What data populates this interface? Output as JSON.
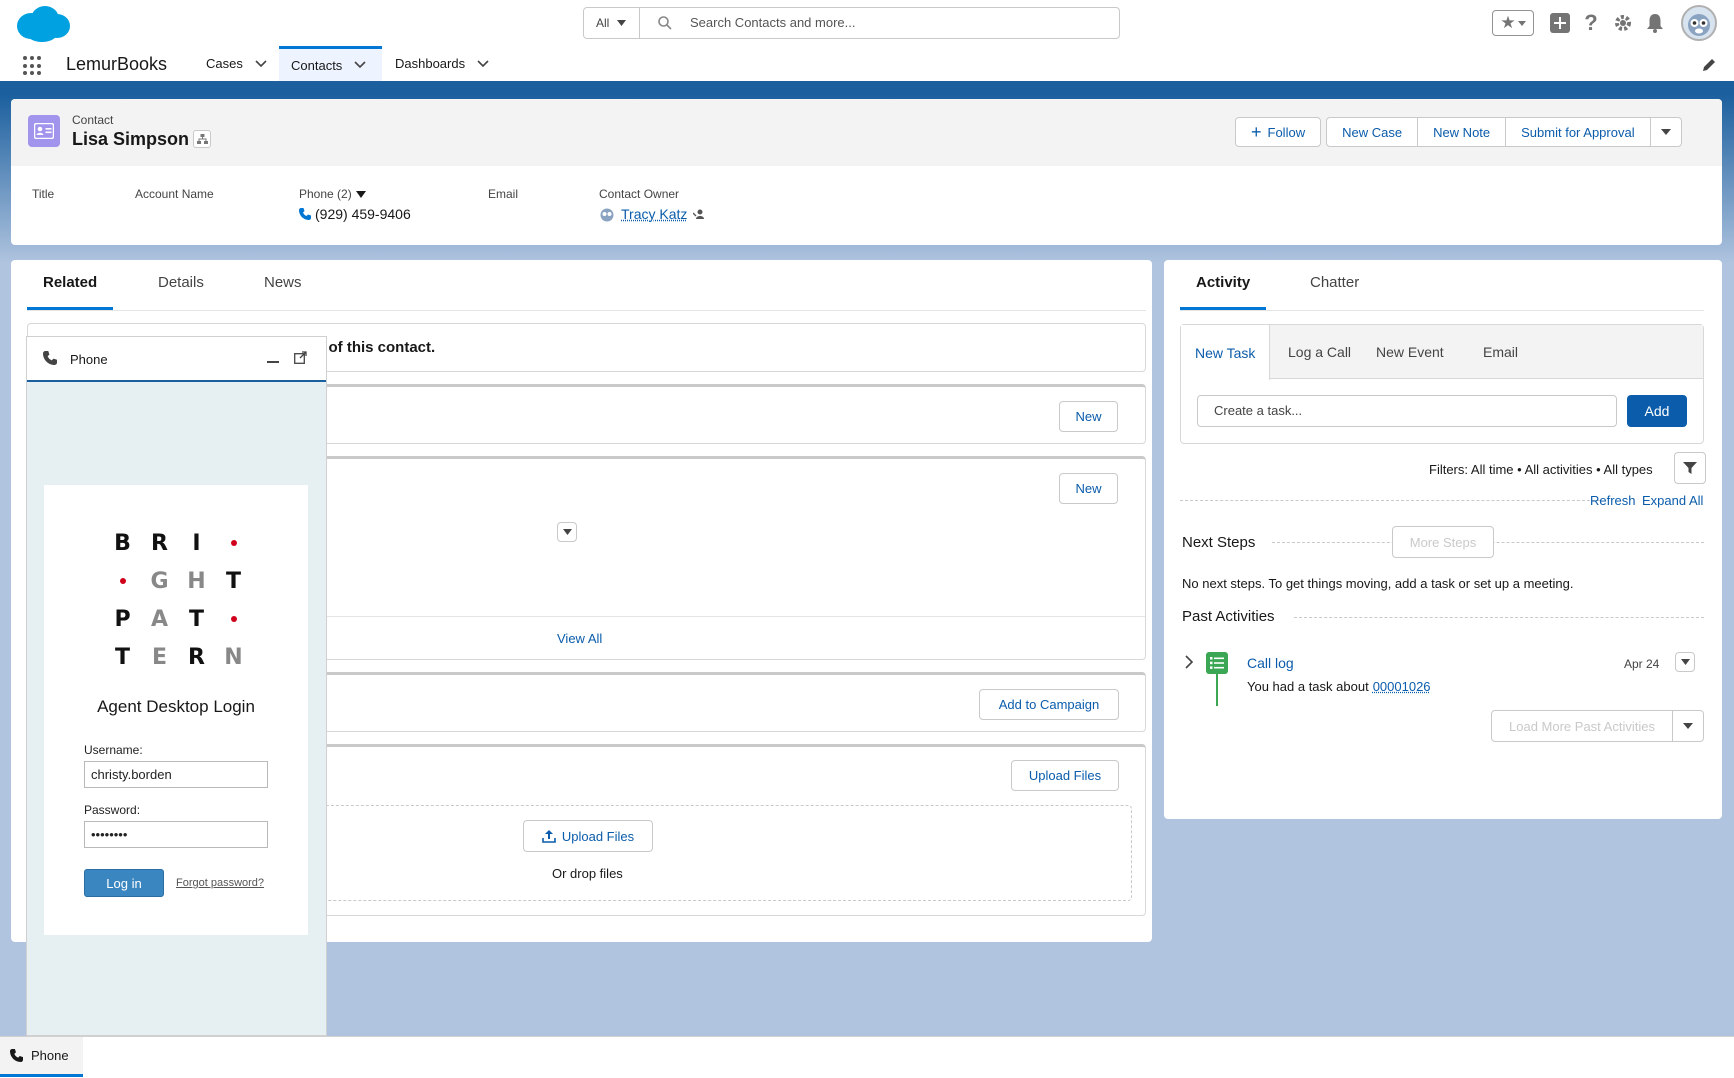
{
  "header": {
    "search_scope": "All",
    "search_placeholder": "Search Contacts and more..."
  },
  "nav": {
    "app_name": "LemurBooks",
    "tabs": [
      {
        "label": "Cases"
      },
      {
        "label": "Contacts"
      },
      {
        "label": "Dashboards"
      }
    ],
    "active_tab": "Contacts"
  },
  "record": {
    "object_label": "Contact",
    "name": "Lisa Simpson",
    "actions": {
      "follow": "Follow",
      "new_case": "New Case",
      "new_note": "New Note",
      "submit": "Submit for Approval"
    },
    "fields": {
      "title_label": "Title",
      "account_label": "Account Name",
      "phone_label": "Phone (2)",
      "phone_value": "(929) 459-9406",
      "email_label": "Email",
      "owner_label": "Contact Owner",
      "owner_value": "Tracy Katz"
    }
  },
  "left_tabs": {
    "related": "Related",
    "details": "Details",
    "news": "News"
  },
  "related": {
    "banner_fragment": "s of this contact.",
    "new_1": "New",
    "new_2": "New",
    "view_all": "View All",
    "add_to_campaign": "Add to Campaign",
    "upload_files_header": "Upload Files",
    "upload_files_button": "Upload Files",
    "drop_files": "Or drop files"
  },
  "phone_panel": {
    "title": "Phone",
    "logo_letters": [
      "B",
      "R",
      "I",
      "•",
      "•",
      "G",
      "H",
      "T",
      "P",
      "A",
      "T",
      "•",
      "T",
      "E",
      "R",
      "N"
    ],
    "login_title": "Agent Desktop Login",
    "username_label": "Username:",
    "username_value": "christy.borden",
    "password_label": "Password:",
    "password_value": "••••••••",
    "login_button": "Log in",
    "forgot_password": "Forgot password?"
  },
  "activity": {
    "tabs": {
      "activity": "Activity",
      "chatter": "Chatter"
    },
    "composer_tabs": [
      "New Task",
      "Log a Call",
      "New Event",
      "Email"
    ],
    "task_placeholder": "Create a task...",
    "add_button": "Add",
    "filters": "Filters: All time • All activities • All types",
    "refresh": "Refresh",
    "expand_all": "Expand All",
    "next_steps": "Next Steps",
    "more_steps": "More Steps",
    "no_next_steps": "No next steps. To get things moving, add a task or set up a meeting.",
    "past_activities": "Past Activities",
    "call_log_title": "Call log",
    "call_log_date": "Apr 24",
    "call_log_text": "You had a task about",
    "call_log_link": "00001026",
    "load_more": "Load More Past Activities"
  },
  "utility_bar": {
    "phone": "Phone"
  },
  "colors": {
    "brand_blue": "#0176d3",
    "link_blue": "#0b5cab",
    "header_band": "#1b5f9e",
    "background": "#b0c4df",
    "contact_icon": "#a094ed",
    "task_icon": "#3ba755",
    "logo_dot": "#d0021b"
  }
}
